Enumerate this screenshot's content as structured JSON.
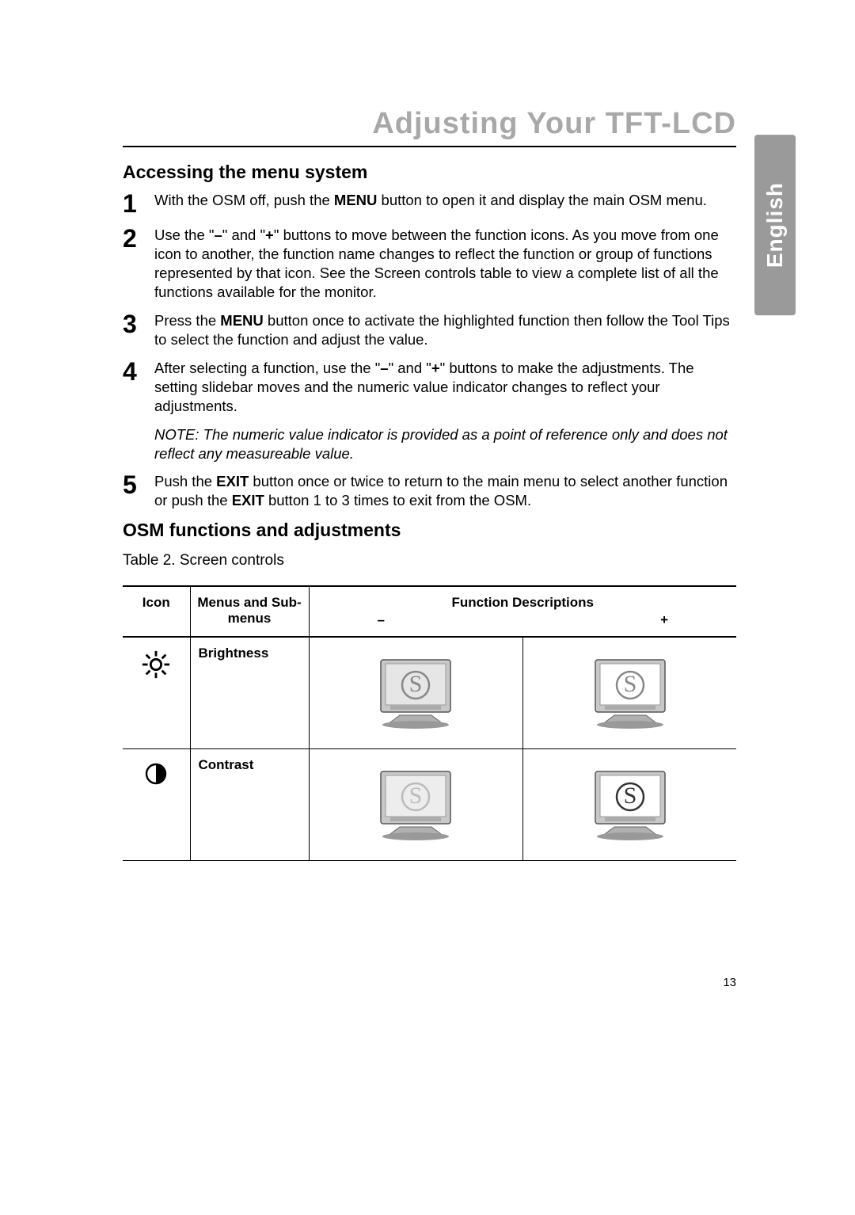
{
  "title": "Adjusting Your TFT-LCD",
  "language": "English",
  "section1": {
    "heading": "Accessing the menu system",
    "steps": [
      {
        "num": "1",
        "html": "With the OSM off, push the <strong>MENU</strong> button to open it and display the main OSM menu."
      },
      {
        "num": "2",
        "html": "Use the \"<strong>–</strong>\" and \"<strong>+</strong>\" buttons to move between the function icons. As you move from one icon to another, the function name changes to reflect the function or group of functions represented by that icon. See the Screen controls table to view a complete list of all the functions available for the monitor."
      },
      {
        "num": "3",
        "html": "Press the <strong>MENU</strong> button once to activate the highlighted function then follow the Tool Tips to select the function and adjust the value."
      },
      {
        "num": "4",
        "html": "After selecting a function, use the \"<strong>–</strong>\" and \"<strong>+</strong>\" buttons to make the adjustments. The setting slidebar moves and the numeric value indicator changes to reflect your adjustments."
      }
    ],
    "note": "NOTE: The numeric value indicator is provided as a point of reference only and does not reflect any measureable value.",
    "step5": {
      "num": "5",
      "html": "Push the <strong>EXIT</strong> button once or twice to return to the main menu to select another function or push the <strong>EXIT</strong> button 1 to 3 times to exit from the OSM."
    }
  },
  "section2": {
    "heading": "OSM functions and adjustments",
    "table_caption": "Table 2.  Screen controls",
    "headers": {
      "icon": "Icon",
      "menus": "Menus and Sub-menus",
      "desc": "Function Descriptions",
      "minus": "–",
      "plus": "+"
    },
    "rows": [
      {
        "icon": "brightness",
        "menu": "Brightness"
      },
      {
        "icon": "contrast",
        "menu": "Contrast"
      }
    ]
  },
  "page_number": "13"
}
